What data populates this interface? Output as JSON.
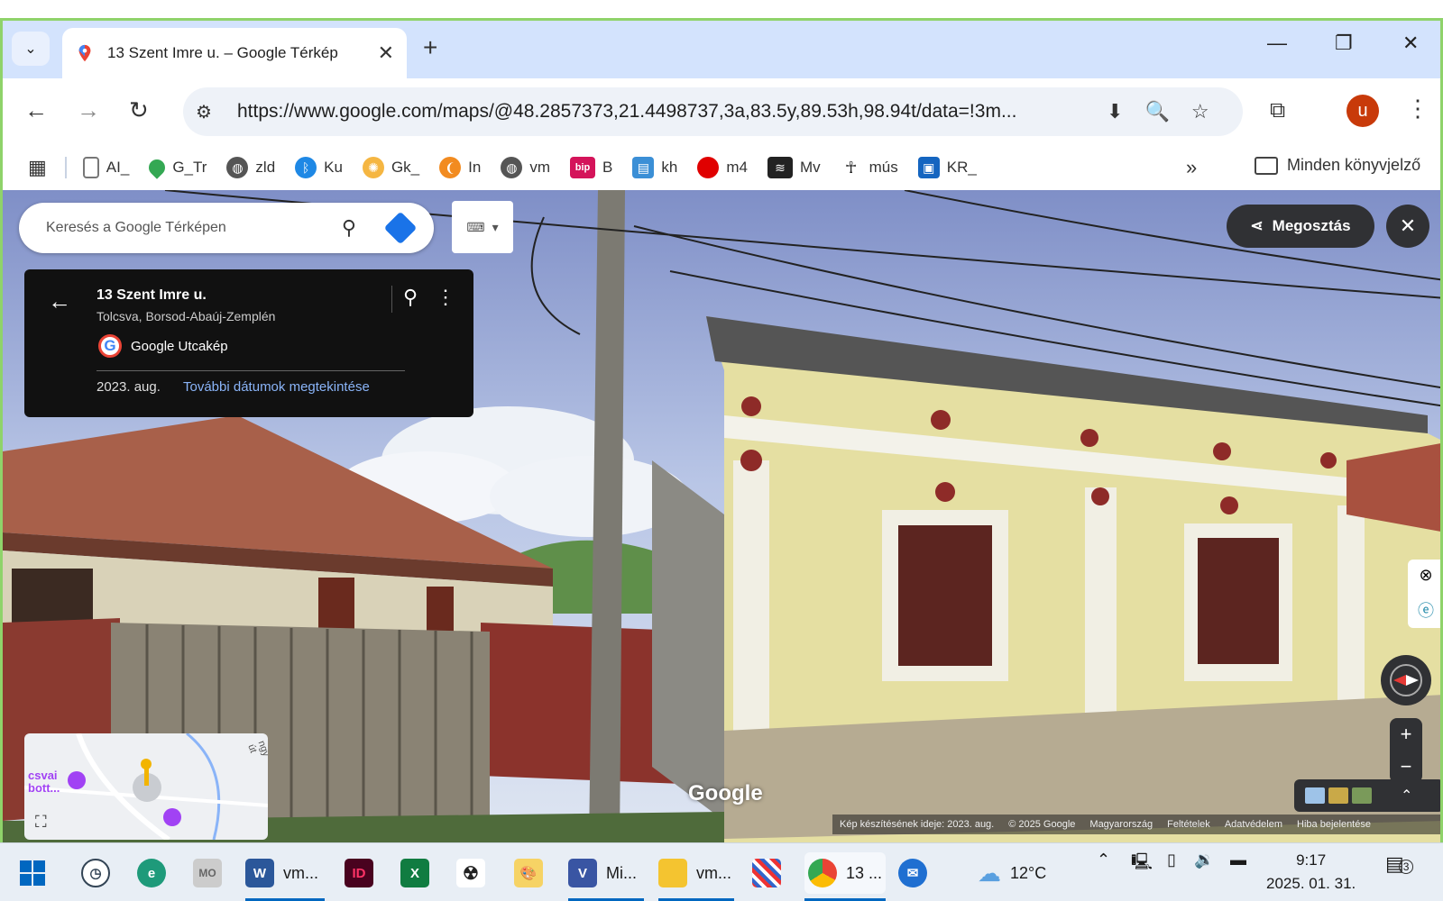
{
  "browser": {
    "tab_title": "13 Szent Imre u. – Google Térkép",
    "url": "https://www.google.com/maps/@48.2857373,21.4498737,3a,83.5y,89.53h,98.94t/data=!3m..."
  },
  "bookmarks": {
    "items": [
      {
        "label": "AI_",
        "icon": "page-icon"
      },
      {
        "label": "G_Tr",
        "icon": "maps-pin-icon"
      },
      {
        "label": "zld",
        "icon": "globe-icon"
      },
      {
        "label": "Ku",
        "icon": "bluetooth-icon"
      },
      {
        "label": "Gk_",
        "icon": "sun-icon"
      },
      {
        "label": "In",
        "icon": "leaf-icon"
      },
      {
        "label": "vm",
        "icon": "globe-icon"
      },
      {
        "label": "B",
        "icon": "bip-icon",
        "badge": "bip"
      },
      {
        "label": "kh",
        "icon": "chart-icon"
      },
      {
        "label": "m4",
        "icon": "red-dot-icon"
      },
      {
        "label": "Mv",
        "icon": "mv-icon"
      },
      {
        "label": "mús",
        "icon": "figure-icon"
      },
      {
        "label": "KR_",
        "icon": "radio-icon"
      }
    ],
    "more": "»",
    "folder": "Minden könyvjelző"
  },
  "maps": {
    "search_placeholder": "Keresés a Google Térképen",
    "card": {
      "address": "13 Szent Imre u.",
      "location": "Tolcsva, Borsod-Abaúj-Zemplén",
      "source": "Google Utcakép",
      "date": "2023. aug.",
      "more_dates": "További dátumok megtekintése"
    },
    "share_label": "Megosztás",
    "watermark": "Google",
    "minimap": {
      "place_label": "csvai\nbott...",
      "road_label": "ngy út"
    },
    "footer": [
      "Kép készítésének ideje: 2023. aug.",
      "© 2025 Google",
      "Magyarország",
      "Feltételek",
      "Adatvédelem",
      "Hiba bejelentése"
    ]
  },
  "taskbar": {
    "apps": [
      {
        "label": "vm...",
        "icon": "word-icon"
      },
      {
        "label": "Mi...",
        "icon": "visio-icon"
      },
      {
        "label": "vm...",
        "icon": "folder-icon"
      },
      {
        "label": "13 ...",
        "icon": "chrome-icon"
      }
    ],
    "weather": "12°C",
    "time": "9:17",
    "date": "2025. 01. 31.",
    "notifications": "3"
  },
  "colors": {
    "accent_blue": "#1a73e8",
    "avatar": "#c83a0a",
    "frame_green": "#8fd36a"
  }
}
